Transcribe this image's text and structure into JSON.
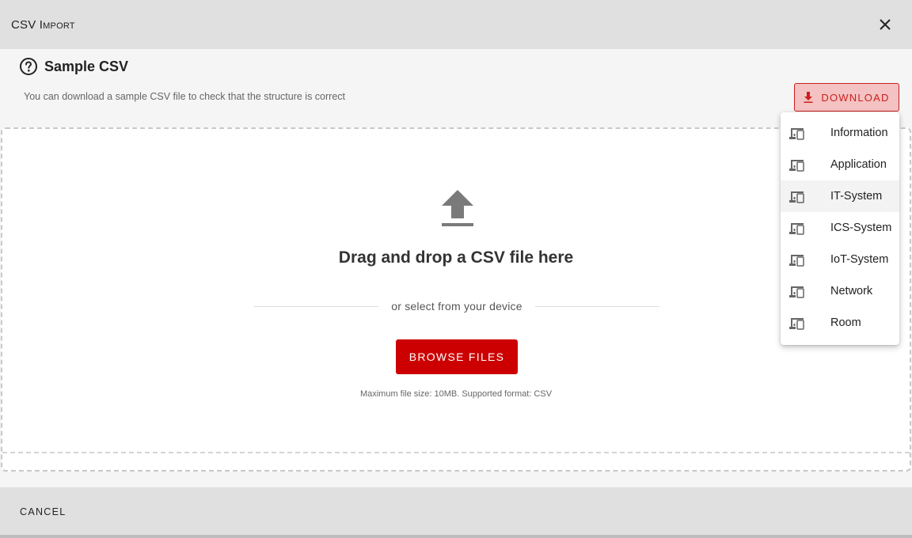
{
  "dialog": {
    "title": "CSV Import",
    "close_icon": "close-icon"
  },
  "sample": {
    "title": "Sample CSV",
    "description": "You can download a sample CSV file to check that the structure is correct",
    "help_icon": "help-circle-icon",
    "download_label": "Download",
    "download_icon": "download-icon"
  },
  "dropzone": {
    "upload_icon": "upload-icon",
    "headline": "Drag and drop a CSV file here",
    "or_text": "or select from your device",
    "browse_label": "Browse Files",
    "limits": "Maximum file size: 10MB. Supported format: CSV"
  },
  "menu": {
    "item_icon": "devices-icon",
    "items": [
      {
        "label": "Information"
      },
      {
        "label": "Application"
      },
      {
        "label": "IT-System"
      },
      {
        "label": "ICS-System"
      },
      {
        "label": "IoT-System"
      },
      {
        "label": "Network"
      },
      {
        "label": "Room"
      }
    ],
    "highlighted": "IT-System"
  },
  "footer": {
    "cancel_label": "Cancel"
  },
  "colors": {
    "accent": "#cc0000",
    "download_bg": "#f4c2c2",
    "header_bg": "#e0e0e0",
    "page_bg": "#f5f5f5"
  }
}
